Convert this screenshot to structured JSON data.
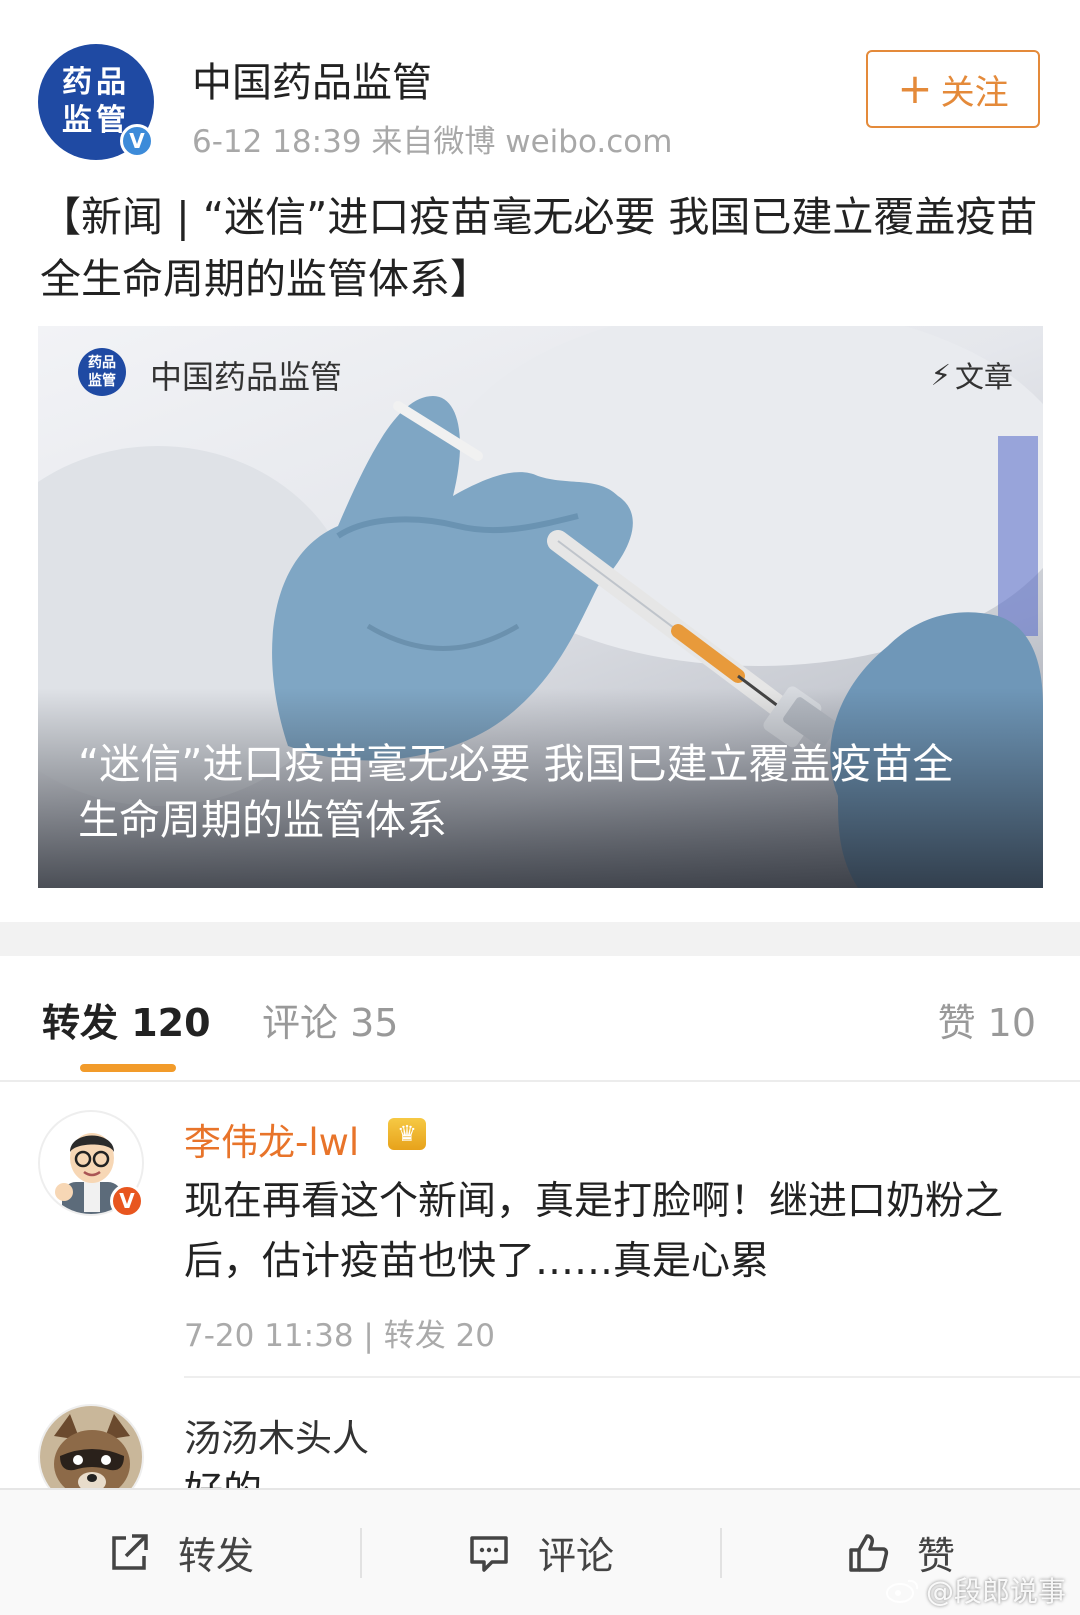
{
  "post": {
    "avatar_lines": [
      "药品",
      "监管"
    ],
    "verified_mark": "V",
    "author": "中国药品监管",
    "meta": "6-12 18:39  来自微博 weibo.com",
    "follow_plus": "+",
    "follow_label": "关注",
    "headline": "【新闻 | “迷信”进口疫苗毫无必要 我国已建立覆盖疫苗全生命周期的监管体系】"
  },
  "card": {
    "logo_lines": [
      "药品",
      "监管"
    ],
    "source": "中国药品监管",
    "type_icon": "⚡",
    "type_label": "文章",
    "title": "“迷信”进口疫苗毫无必要 我国已建立覆盖疫苗全生命周期的监管体系"
  },
  "tabs": {
    "reposts": "转发 120",
    "comments": "评论 35",
    "likes": "赞 10"
  },
  "reposts": [
    {
      "name": "李伟龙-lwl",
      "name_color": "#e8742a",
      "badge": "♛",
      "text": "现在再看这个新闻，真是打脸啊！继进口奶粉之后，估计疫苗也快了……真是心累",
      "meta": "7-20 11:38 | 转发 20"
    },
    {
      "name": "汤汤木头人",
      "name_color": "#333333",
      "text": "好的"
    }
  ],
  "toolbar": {
    "repost": "转发",
    "comment": "评论",
    "like": "赞"
  },
  "watermark": "@段郎说事",
  "colors": {
    "accent": "#e48a3a",
    "brand_blue": "#1f4aa3",
    "tab_underline": "#f29b2a"
  }
}
